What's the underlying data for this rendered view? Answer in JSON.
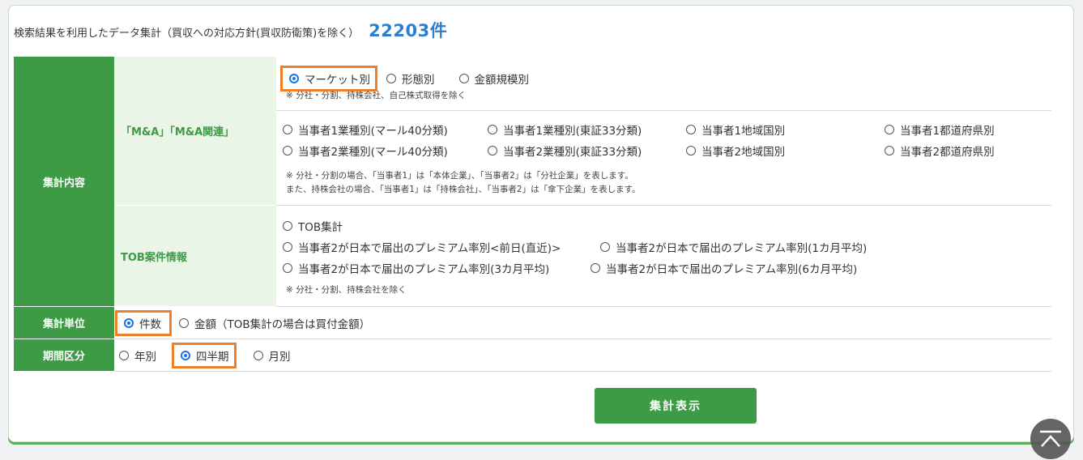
{
  "header": {
    "description": "検索結果を利用したデータ集計（買収への対応方針(買収防衛策)を除く）",
    "count": "22203件"
  },
  "sections": {
    "content_label": "集計内容",
    "ma_label": "「M&A」「M&A関連」",
    "tob_label": "TOB案件情報",
    "unit_label": "集計単位",
    "period_label": "期間区分"
  },
  "ma_options": {
    "market": "マーケット別",
    "form": "形態別",
    "amount_scale": "金額規模別",
    "note1": "※ 分社・分割、持株会社、自己株式取得を除く",
    "p1_industry40": "当事者1業種別(マール40分類)",
    "p1_tse33": "当事者1業種別(東証33分類)",
    "p1_region": "当事者1地域国別",
    "p1_pref": "当事者1都道府県別",
    "p2_industry40": "当事者2業種別(マール40分類)",
    "p2_tse33": "当事者2業種別(東証33分類)",
    "p2_region": "当事者2地域国別",
    "p2_pref": "当事者2都道府県別",
    "note2_line1": "※ 分社・分割の場合、「当事者1」は「本体企業」、「当事者2」は「分社企業」を表します。",
    "note2_line2": "また、持株会社の場合、「当事者1」は「持株会社」、「当事者2」は「傘下企業」を表します。"
  },
  "tob_options": {
    "tob_total": "TOB集計",
    "premium_prev": "当事者2が日本で届出のプレミアム率別<前日(直近)>",
    "premium_1m": "当事者2が日本で届出のプレミアム率別(1カ月平均)",
    "premium_3m": "当事者2が日本で届出のプレミアム率別(3カ月平均)",
    "premium_6m": "当事者2が日本で届出のプレミアム率別(6カ月平均)",
    "note": "※ 分社・分割、持株会社を除く"
  },
  "unit_options": {
    "count": "件数",
    "amount": "金額（TOB集計の場合は買付金額）"
  },
  "period_options": {
    "yearly": "年別",
    "quarterly": "四半期",
    "monthly": "月別"
  },
  "actions": {
    "submit": "集計表示"
  },
  "colors": {
    "accent": "#3d9b45",
    "highlight": "#f07f2a",
    "count": "#2a7fd0"
  }
}
